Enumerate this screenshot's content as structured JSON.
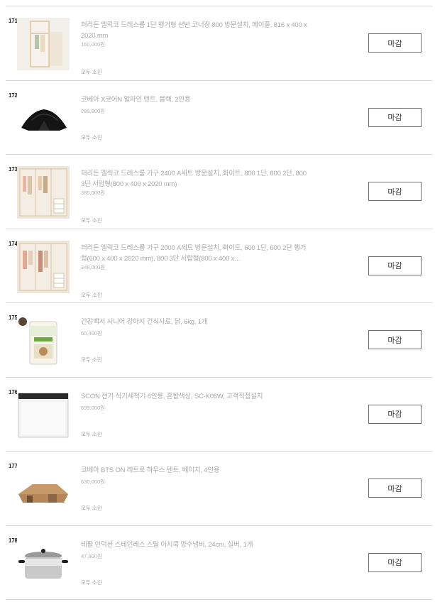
{
  "items": [
    {
      "number": "171",
      "title": "퍼리든 엘릭코 드레스룸 1단 행거형 선반 코너장 800 방문설치, 메이플, 816 x 400 x 2020 mm",
      "price": "160,000원",
      "status": "모두 소진",
      "button": "마감",
      "image": "wardrobe-single"
    },
    {
      "number": "172",
      "title": "코베아 X코어N 알파인 텐트, 블랙, 2인용",
      "price": "289,800원",
      "status": "모두 소진",
      "button": "마감",
      "image": "tent-black"
    },
    {
      "number": "173",
      "title": "퍼리든 엘릭코 드레스룸 가구 2400 A세트 방문설치, 화이트, 800 1단, 800 2단, 800 3단 서랍형(800 x 400 x 2020 mm)",
      "price": "385,000원",
      "status": "모두 소진",
      "button": "마감",
      "image": "wardrobe-set"
    },
    {
      "number": "174",
      "title": "퍼리든 엘릭코 드레스룸 가구 2000 A세트 방문설치, 화이트, 600 1단, 600 2단 행거형(600 x 400 x 2020 mm), 800 3단 서랍형(800 x 400 x…",
      "price": "348,000원",
      "status": "모두 소진",
      "button": "마감",
      "image": "wardrobe-set"
    },
    {
      "number": "175",
      "title": "건강백서 시니어 강아지 건식사료, 닭, 6kg, 1개",
      "price": "60,400원",
      "status": "모두 소진",
      "button": "마감",
      "image": "dog-food-bag"
    },
    {
      "number": "176",
      "title": "SCON 전기 식기세척기 6인용, 혼합색상, SC-K06W, 고객직접설치",
      "price": "699,000원",
      "status": "모두 소진",
      "button": "마감",
      "image": "dishwasher"
    },
    {
      "number": "177",
      "title": "코베아 BTS ON 레트로 하우스 텐트, 베이지, 4인용",
      "price": "630,000원",
      "status": "모두 소진",
      "button": "마감",
      "image": "tent-beige"
    },
    {
      "number": "178",
      "title": "테팔 인덕션 스테인레스 스틸 이지쿡 양수냄비, 24cm, 실버, 1개",
      "price": "47,900원",
      "status": "모두 소진",
      "button": "마감",
      "image": "stock-pot"
    }
  ]
}
